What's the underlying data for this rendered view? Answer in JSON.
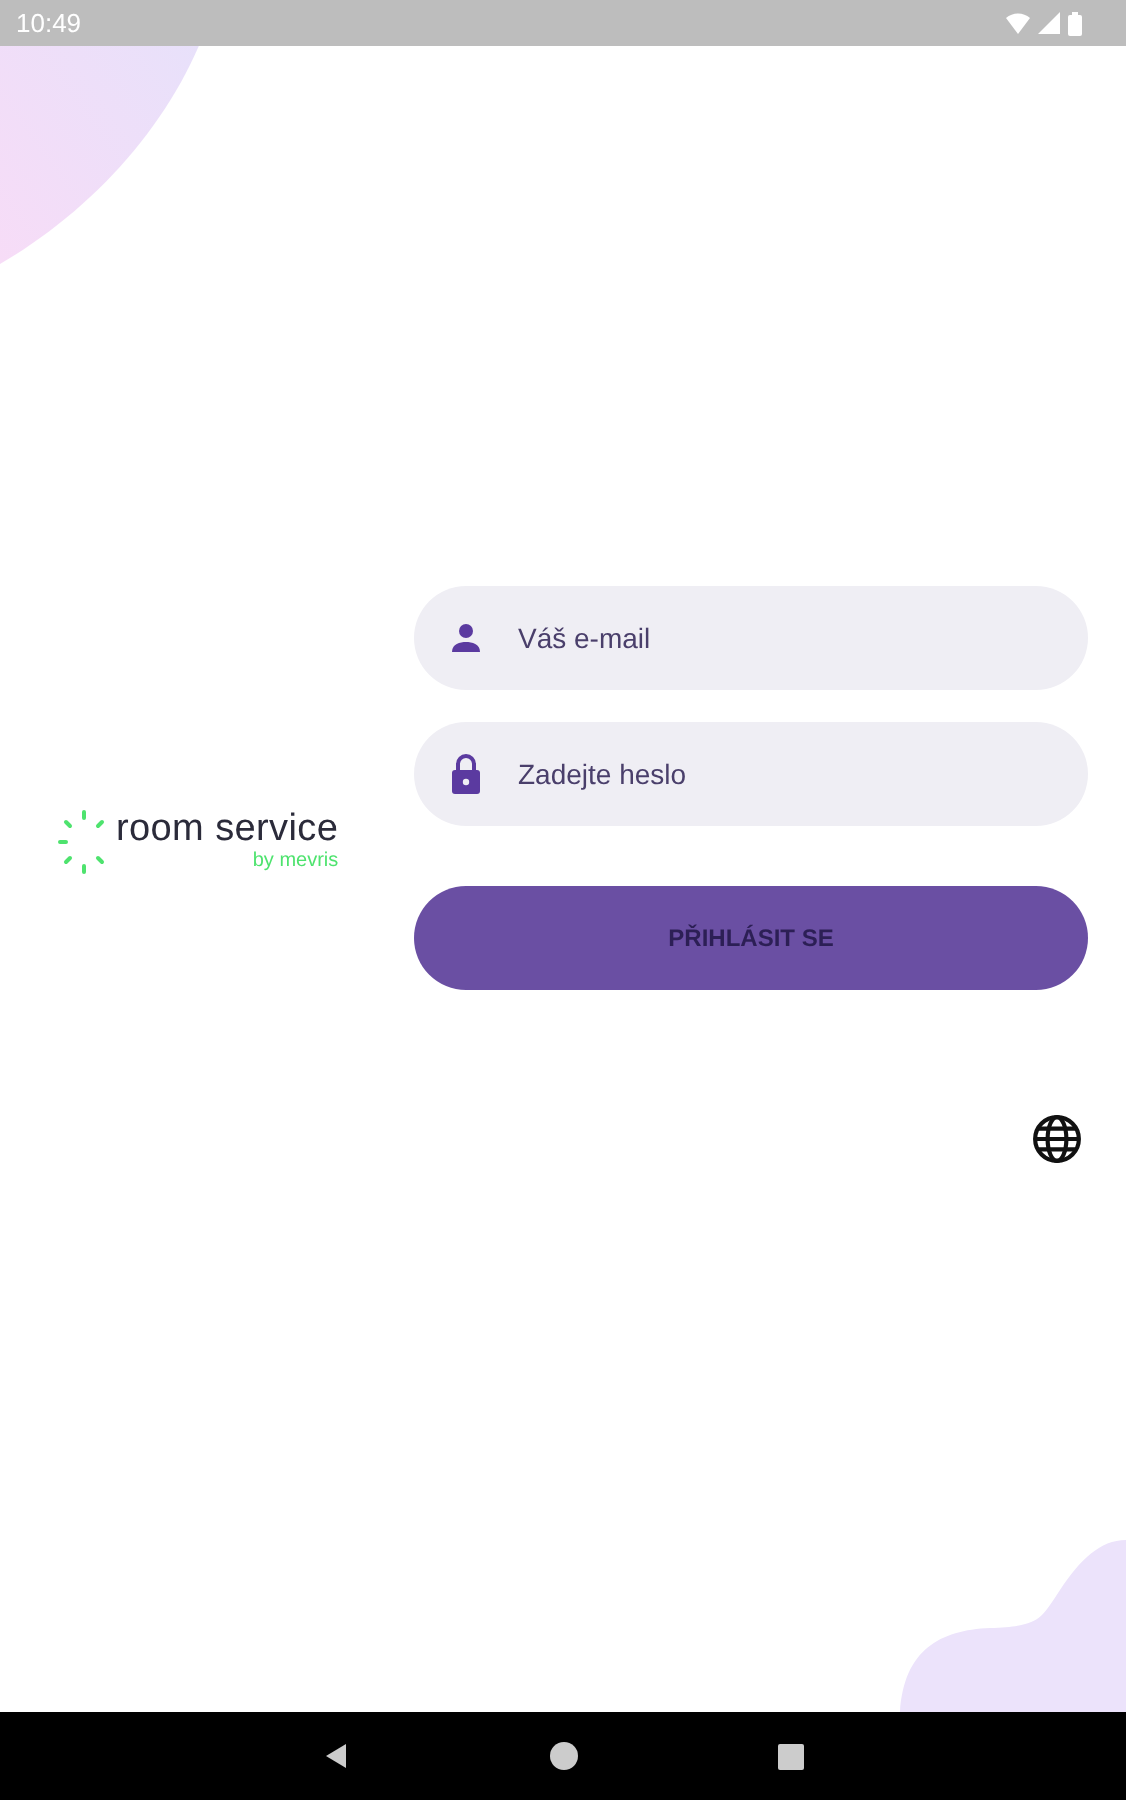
{
  "status_bar": {
    "time": "10:49"
  },
  "logo": {
    "name": "room service",
    "tagline": "by mevris"
  },
  "fields": [
    {
      "kind": "user",
      "placeholder": "Váš e-mail"
    },
    {
      "kind": "lock",
      "placeholder": "Zadejte heslo"
    }
  ],
  "login_button": {
    "label": "PŘIHLÁSIT SE"
  }
}
